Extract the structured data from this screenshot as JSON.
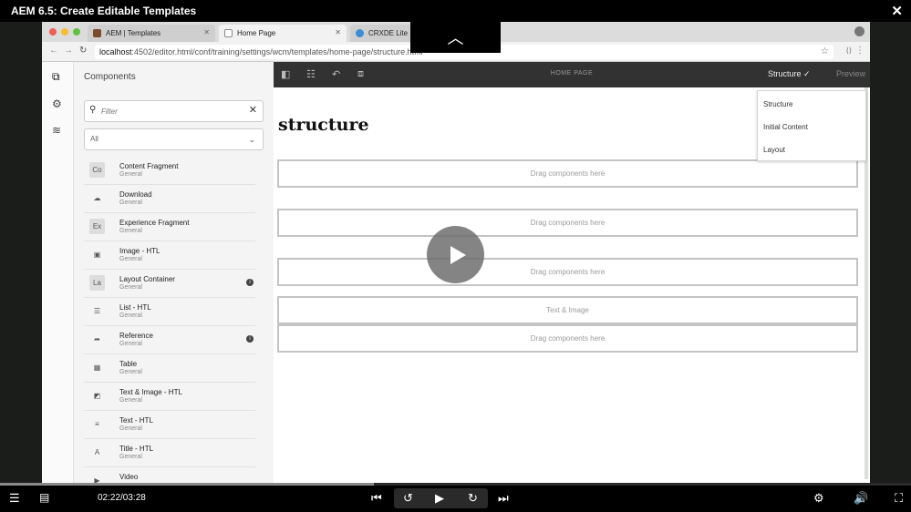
{
  "player": {
    "title": "AEM 6.5: Create Editable Templates",
    "close_icon": "close-icon",
    "time": "02:22/03:28",
    "progress": 0.41
  },
  "browser": {
    "tabs": [
      {
        "label": "AEM | Templates"
      },
      {
        "label": "Home Page"
      },
      {
        "label": "CRXDE Lite"
      }
    ],
    "url_host": "localhost",
    "url_rest": ":4502/editor.html/conf/training/settings/wcm/templates/home-page/structure.html"
  },
  "panel": {
    "title": "Components",
    "filter_placeholder": "Filter",
    "group_select": "All",
    "components": [
      {
        "abbr": "Co",
        "name": "Content Fragment",
        "group": "General",
        "info": false,
        "icon": "content-fragment-icon"
      },
      {
        "abbr": "☁",
        "name": "Download",
        "group": "General",
        "info": false,
        "icon": "download-cloud-icon"
      },
      {
        "abbr": "Ex",
        "name": "Experience Fragment",
        "group": "General",
        "info": false,
        "icon": "experience-fragment-icon"
      },
      {
        "abbr": "▣",
        "name": "Image - HTL",
        "group": "General",
        "info": false,
        "icon": "image-icon"
      },
      {
        "abbr": "La",
        "name": "Layout Container",
        "group": "General",
        "info": true,
        "icon": "layout-container-icon"
      },
      {
        "abbr": "☰",
        "name": "List - HTL",
        "group": "General",
        "info": false,
        "icon": "list-icon"
      },
      {
        "abbr": "➦",
        "name": "Reference",
        "group": "General",
        "info": true,
        "icon": "reference-icon"
      },
      {
        "abbr": "▦",
        "name": "Table",
        "group": "General",
        "info": false,
        "icon": "table-icon"
      },
      {
        "abbr": "◩",
        "name": "Text & Image - HTL",
        "group": "General",
        "info": false,
        "icon": "text-image-icon"
      },
      {
        "abbr": "≡",
        "name": "Text - HTL",
        "group": "General",
        "info": false,
        "icon": "text-icon"
      },
      {
        "abbr": "A",
        "name": "Title - HTL",
        "group": "General",
        "info": false,
        "icon": "title-icon"
      },
      {
        "abbr": "▶",
        "name": "Video",
        "group": "",
        "info": false,
        "icon": "video-icon"
      }
    ]
  },
  "editor": {
    "page_title": "HOME PAGE",
    "mode": "Structure",
    "preview": "Preview",
    "heading": "structure",
    "drop_zones": [
      "Drag components here",
      "Drag components here",
      "Drag components here",
      "Text & Image",
      "Drag components here"
    ],
    "mode_options": [
      "Structure",
      "Initial Content",
      "Layout"
    ]
  }
}
